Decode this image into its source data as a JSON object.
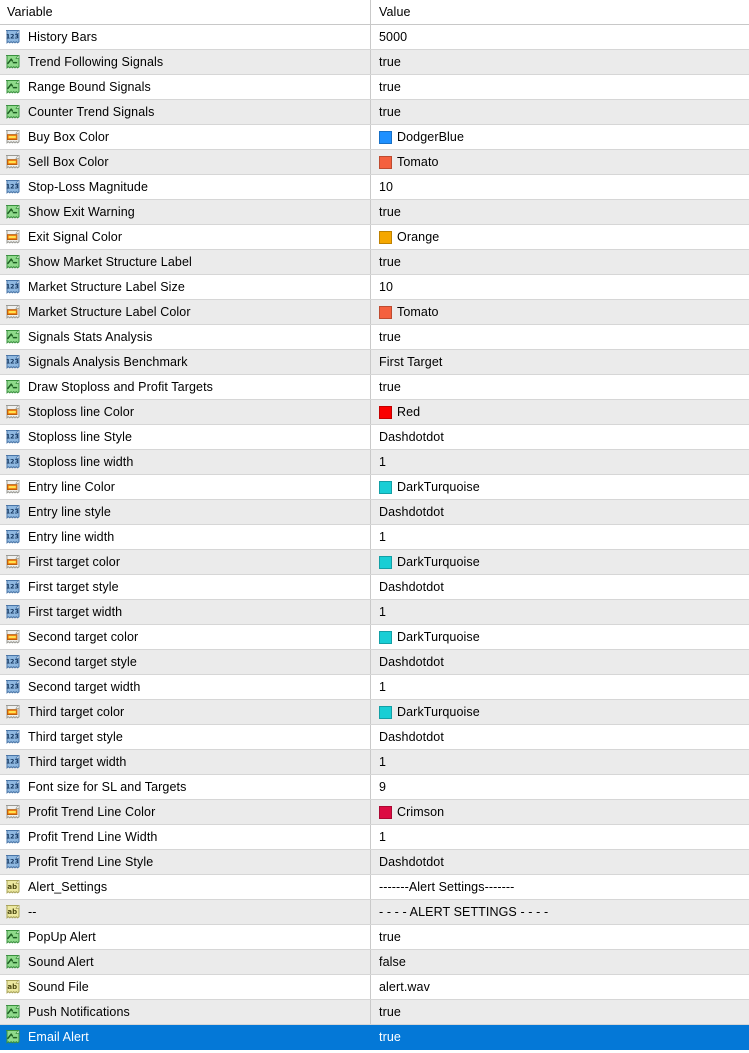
{
  "header": {
    "variable": "Variable",
    "value": "Value"
  },
  "colors": {
    "selection_blue": "#0478d7",
    "row_even": "#ebebeb",
    "row_odd": "#ffffff",
    "grid_line": "#d6d6d6",
    "DodgerBlue": "#1e90ff",
    "Tomato": "#f4603e",
    "Orange": "#f5a700",
    "Red": "#fa0000",
    "DarkTurquoise": "#19ced5",
    "Crimson": "#dc0b42"
  },
  "rows": [
    {
      "icon": "integer-icon",
      "variable": "History Bars",
      "value": "5000"
    },
    {
      "icon": "boolean-icon",
      "variable": "Trend Following Signals",
      "value": "true"
    },
    {
      "icon": "boolean-icon",
      "variable": "Range Bound Signals",
      "value": "true"
    },
    {
      "icon": "boolean-icon",
      "variable": "Counter Trend Signals",
      "value": "true"
    },
    {
      "icon": "color-icon",
      "variable": "Buy Box Color",
      "value": "DodgerBlue",
      "swatch": "#1e90ff"
    },
    {
      "icon": "color-icon",
      "variable": "Sell Box Color",
      "value": "Tomato",
      "swatch": "#f4603e"
    },
    {
      "icon": "integer-icon",
      "variable": "Stop-Loss Magnitude",
      "value": "10"
    },
    {
      "icon": "boolean-icon",
      "variable": "Show Exit Warning",
      "value": "true"
    },
    {
      "icon": "color-icon",
      "variable": "Exit Signal Color",
      "value": "Orange",
      "swatch": "#f5a700"
    },
    {
      "icon": "boolean-icon",
      "variable": "Show Market Structure Label",
      "value": "true"
    },
    {
      "icon": "integer-icon",
      "variable": "Market Structure Label Size",
      "value": "10"
    },
    {
      "icon": "color-icon",
      "variable": "Market Structure Label Color",
      "value": "Tomato",
      "swatch": "#f4603e"
    },
    {
      "icon": "boolean-icon",
      "variable": "Signals Stats Analysis",
      "value": "true"
    },
    {
      "icon": "integer-icon",
      "variable": "Signals Analysis Benchmark",
      "value": "First Target"
    },
    {
      "icon": "boolean-icon",
      "variable": "Draw Stoploss and Profit Targets",
      "value": "true"
    },
    {
      "icon": "color-icon",
      "variable": "Stoploss line Color",
      "value": "Red",
      "swatch": "#fa0000"
    },
    {
      "icon": "integer-icon",
      "variable": "Stoploss line Style",
      "value": "Dashdotdot"
    },
    {
      "icon": "integer-icon",
      "variable": "Stoploss line width",
      "value": "1"
    },
    {
      "icon": "color-icon",
      "variable": "Entry line Color",
      "value": "DarkTurquoise",
      "swatch": "#19ced5"
    },
    {
      "icon": "integer-icon",
      "variable": "Entry line style",
      "value": "Dashdotdot"
    },
    {
      "icon": "integer-icon",
      "variable": "Entry line width",
      "value": "1"
    },
    {
      "icon": "color-icon",
      "variable": "First target color",
      "value": "DarkTurquoise",
      "swatch": "#19ced5"
    },
    {
      "icon": "integer-icon",
      "variable": "First target style",
      "value": "Dashdotdot"
    },
    {
      "icon": "integer-icon",
      "variable": "First target width",
      "value": "1"
    },
    {
      "icon": "color-icon",
      "variable": "Second target color",
      "value": "DarkTurquoise",
      "swatch": "#19ced5"
    },
    {
      "icon": "integer-icon",
      "variable": "Second target style",
      "value": "Dashdotdot"
    },
    {
      "icon": "integer-icon",
      "variable": "Second target width",
      "value": "1"
    },
    {
      "icon": "color-icon",
      "variable": "Third target color",
      "value": "DarkTurquoise",
      "swatch": "#19ced5"
    },
    {
      "icon": "integer-icon",
      "variable": "Third target style",
      "value": "Dashdotdot"
    },
    {
      "icon": "integer-icon",
      "variable": "Third target width",
      "value": "1"
    },
    {
      "icon": "integer-icon",
      "variable": "Font size for SL and Targets",
      "value": "9"
    },
    {
      "icon": "color-icon",
      "variable": "Profit Trend Line Color",
      "value": "Crimson",
      "swatch": "#dc0b42"
    },
    {
      "icon": "integer-icon",
      "variable": "Profit Trend Line Width",
      "value": "1"
    },
    {
      "icon": "integer-icon",
      "variable": "Profit Trend Line Style",
      "value": "Dashdotdot"
    },
    {
      "icon": "string-icon",
      "variable": "Alert_Settings",
      "value": "-------Alert Settings-------"
    },
    {
      "icon": "string-icon",
      "variable": "--",
      "value": "- - - - ALERT SETTINGS - - - -"
    },
    {
      "icon": "boolean-icon",
      "variable": "PopUp Alert",
      "value": "true"
    },
    {
      "icon": "boolean-icon",
      "variable": "Sound Alert",
      "value": "false"
    },
    {
      "icon": "string-icon",
      "variable": "Sound File",
      "value": "alert.wav"
    },
    {
      "icon": "boolean-icon",
      "variable": "Push Notifications",
      "value": "true"
    },
    {
      "icon": "boolean-icon",
      "variable": "Email Alert",
      "value": "true",
      "selected": true
    }
  ]
}
